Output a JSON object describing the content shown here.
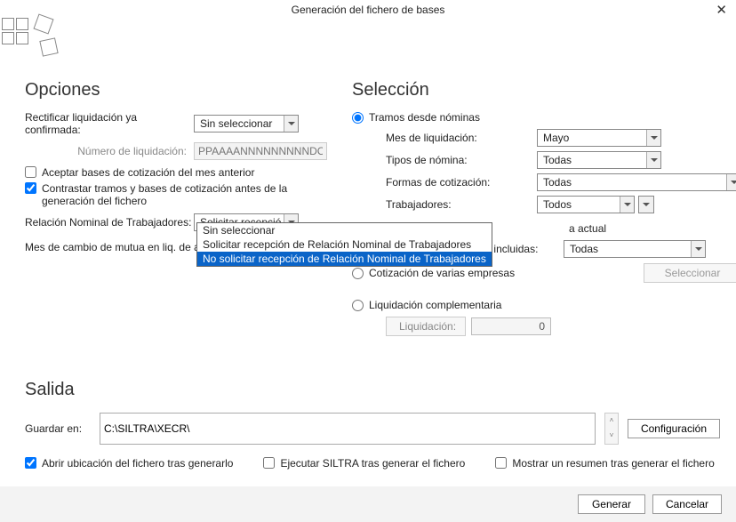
{
  "title": "Generación del fichero de bases",
  "sections": {
    "opciones": "Opciones",
    "seleccion": "Selección",
    "salida": "Salida"
  },
  "opciones": {
    "rectificar_label": "Rectificar liquidación ya confirmada:",
    "rectificar_value": "Sin seleccionar",
    "num_liq_label": "Número de liquidación:",
    "num_liq_placeholder": "PPAAAANNNNNNNNNDC",
    "chk_aceptar": "Aceptar bases de cotización del mes anterior",
    "chk_contrastar": "Contrastar tramos y bases de cotización antes de la generación del fichero",
    "rnt_label": "Relación Nominal de Trabajadores:",
    "rnt_value": "Solicitar recepció",
    "rnt_options": [
      "Sin seleccionar",
      "Solicitar recepción de Relación Nominal de Trabajadores",
      "No solicitar recepción de Relación Nominal de Trabajadores"
    ],
    "mes_mutua_label": "Mes de cambio de mutua en liq. de atr"
  },
  "seleccion": {
    "radio_tramos": "Tramos desde nóminas",
    "mes_liq_label": "Mes de liquidación:",
    "mes_liq_value": "Mayo",
    "tipos_nomina_label": "Tipos de nómina:",
    "tipos_nomina_value": "Todas",
    "formas_cot_label": "Formas de cotización:",
    "formas_cot_value": "Todas",
    "trabajadores_label": "Trabajadores:",
    "trabajadores_value": "Todos",
    "radio_empresa_actual_suffix": "a actual",
    "cuentas_label": "Cuentas de cotización incluidas:",
    "cuentas_value": "Todas",
    "radio_varias": "Cotización de varias empresas",
    "btn_seleccionar": "Seleccionar",
    "radio_complementaria": "Liquidación complementaria",
    "liq_label": "Liquidación:",
    "liq_value": "0"
  },
  "salida": {
    "guardar_label": "Guardar en:",
    "guardar_value": "C:\\SILTRA\\XECR\\",
    "btn_config": "Configuración",
    "chk_abrir": "Abrir ubicación del fichero tras generarlo",
    "chk_ejecutar": "Ejecutar SILTRA tras generar el fichero",
    "chk_resumen": "Mostrar un resumen tras generar el fichero"
  },
  "buttons": {
    "generar": "Generar",
    "cancelar": "Cancelar"
  }
}
